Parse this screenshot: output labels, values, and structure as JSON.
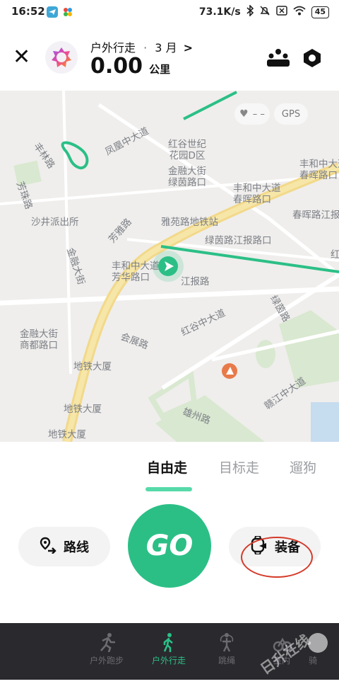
{
  "status_bar": {
    "time": "16:52",
    "net_speed": "73.1K/s",
    "battery": "45"
  },
  "header": {
    "sport_label": "户外行走",
    "separator": "·",
    "month_label": "3 月",
    "chevron": ">",
    "distance_value": "0.00",
    "distance_unit": "公里",
    "close_icon": "close-icon",
    "group_icon": "people-group-icon",
    "settings_icon": "hexagon-settings-icon"
  },
  "map": {
    "heart_rate_label": "– –",
    "gps_label": "GPS",
    "labels": [
      {
        "name": "feng-lin-road",
        "text": "丰林路"
      },
      {
        "name": "feng-huang-road",
        "text": "凤凰中大道"
      },
      {
        "name": "honggu-shiji",
        "text": "红谷世纪",
        "text2": "花园D区"
      },
      {
        "name": "fenghe-chunhui",
        "text": "丰和中大道",
        "text2": "春晖路口"
      },
      {
        "name": "jinrong-lvyin",
        "text": "金融大街",
        "text2": "绿茵路口"
      },
      {
        "name": "fenghe-chunhui-right",
        "text": "丰和中大道",
        "text2": "春晖路口"
      },
      {
        "name": "chunhui-jiangbao",
        "text": "春晖路江报"
      },
      {
        "name": "fangzhu-road",
        "text": "芳珠路"
      },
      {
        "name": "shajing-police",
        "text": "沙井派出所"
      },
      {
        "name": "fanghua-road",
        "text": "芳雅路"
      },
      {
        "name": "yayuan-metro",
        "text": "雅苑路地铁站"
      },
      {
        "name": "lvyin-jiangbao",
        "text": "绿茵路江报路口"
      },
      {
        "name": "jinrong-street",
        "text": "金融大街"
      },
      {
        "name": "fenghe-fanghua",
        "text": "丰和中大道",
        "text2": "芳华路口"
      },
      {
        "name": "jiangbao-road",
        "text": "江报路"
      },
      {
        "name": "honggu-avenue",
        "text": "红谷中大道"
      },
      {
        "name": "lvyin-road",
        "text": "绿茵路"
      },
      {
        "name": "jinrong-shangdu",
        "text": "金融大街",
        "text2": "商都路口"
      },
      {
        "name": "huizhan-road",
        "text": "会展路"
      },
      {
        "name": "metro-building-1",
        "text": "地铁大厦"
      },
      {
        "name": "ganjiang-avenue",
        "text": "赣江中大道"
      },
      {
        "name": "xiongzhou-road",
        "text": "雄州路"
      },
      {
        "name": "metro-building-2",
        "text": "地铁大厦"
      },
      {
        "name": "metro-building-3",
        "text": "地铁大厦"
      },
      {
        "name": "hong-label",
        "text": "红"
      }
    ]
  },
  "mode_tabs": [
    {
      "label": "自由走",
      "active": true
    },
    {
      "label": "目标走",
      "active": false
    },
    {
      "label": "遛狗",
      "active": false
    }
  ],
  "actions": {
    "route_label": "路线",
    "go_label": "GO",
    "gear_label": "装备"
  },
  "bottom_nav": [
    {
      "label": "户外跑步",
      "icon": "running-icon",
      "active": false
    },
    {
      "label": "户外行走",
      "icon": "walking-icon",
      "active": true
    },
    {
      "label": "跳绳",
      "icon": "jump-rope-icon",
      "active": false
    },
    {
      "label": "室内",
      "icon": "indoor-icon",
      "active": false
    },
    {
      "label": "骑",
      "icon": "cycling-icon",
      "active": false
    }
  ],
  "watermark_text": "日升在线",
  "colors": {
    "accent": "#2bbf86",
    "route_line": "#2bbf86",
    "road": "#f2d98a",
    "park": "#d9e8d0",
    "annotation": "#d43a2a",
    "nav_bg": "#2a2a2e"
  }
}
